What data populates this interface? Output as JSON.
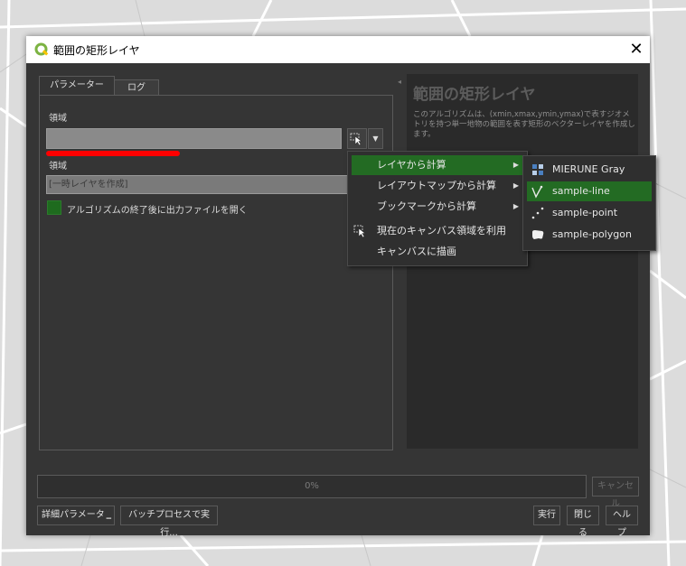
{
  "dialog": {
    "title": "範囲の矩形レイヤ",
    "close_glyph": "✕"
  },
  "tabs": [
    {
      "label": "パラメーター",
      "active": true
    },
    {
      "label": "ログ",
      "active": false
    }
  ],
  "params": {
    "extent_label": "領域",
    "extent_value": "",
    "output_label": "領域",
    "output_placeholder": "[一時レイヤを作成]",
    "open_output_label": "アルゴリズムの終了後に出力ファイルを開く",
    "open_output_checked": true
  },
  "help": {
    "title": "範囲の矩形レイヤ",
    "text": "このアルゴリズムは、(xmin,xmax,ymin,ymax)で表すジオメトリを持つ単一地物の範囲を表す矩形のベクターレイヤを作成します。"
  },
  "extent_menu": {
    "items": [
      {
        "label": "レイヤから計算",
        "submenu": true,
        "highlighted": true
      },
      {
        "label": "レイアウトマップから計算",
        "submenu": true,
        "highlighted": false
      },
      {
        "label": "ブックマークから計算",
        "submenu": true,
        "highlighted": false
      },
      {
        "label": "現在のキャンバス領域を利用",
        "submenu": false,
        "highlighted": false,
        "icon": "map-canvas-icon"
      },
      {
        "label": "キャンバスに描画",
        "submenu": false,
        "highlighted": false
      }
    ]
  },
  "layer_submenu": {
    "items": [
      {
        "label": "MIERUNE Gray",
        "icon": "raster-layer-icon",
        "highlighted": false
      },
      {
        "label": "sample-line",
        "icon": "line-layer-icon",
        "highlighted": true
      },
      {
        "label": "sample-point",
        "icon": "point-layer-icon",
        "highlighted": false
      },
      {
        "label": "sample-polygon",
        "icon": "polygon-layer-icon",
        "highlighted": false
      }
    ]
  },
  "footer": {
    "progress_text": "0%",
    "progress_value": 0,
    "cancel_label": "キャンセル",
    "advanced_label": "詳細パラメータ",
    "batch_label": "バッチプロセスで実行...",
    "run_label": "実行",
    "close_label": "閉じる",
    "help_label": "ヘルプ"
  },
  "colors": {
    "accent": "#236b23",
    "dialog_bg": "#353535",
    "highlight_marker": "#ff0000"
  }
}
